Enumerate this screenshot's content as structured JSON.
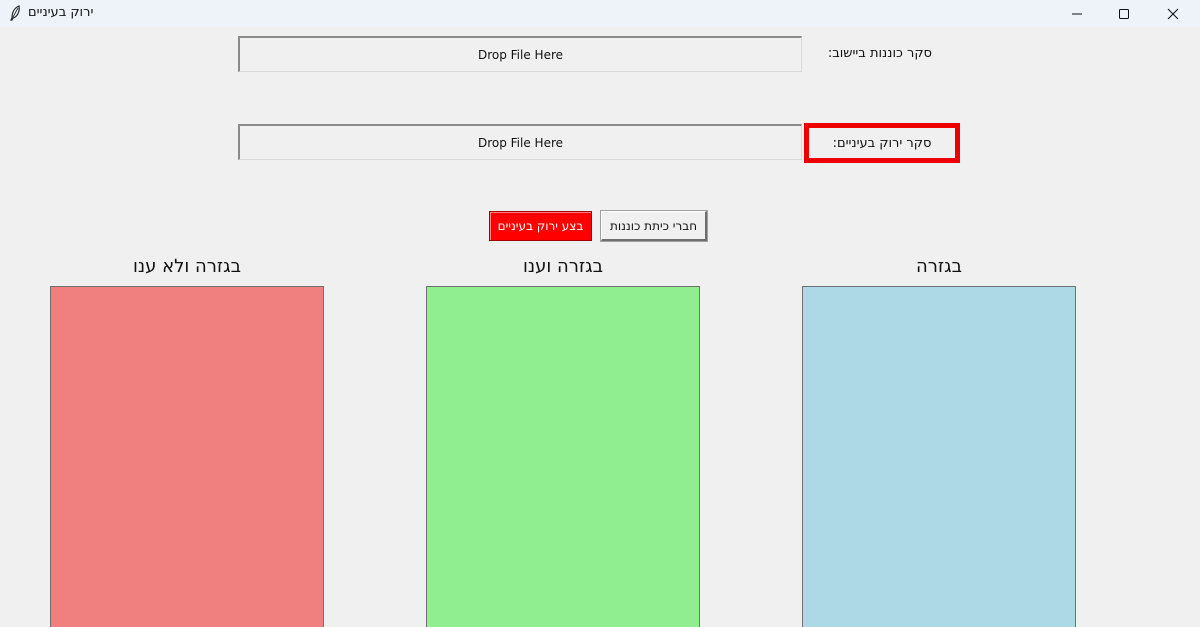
{
  "window": {
    "title": "ירוק בעיניים"
  },
  "inputs": {
    "settlement_survey_label": "סקר כוננות ביישוב:",
    "settlement_survey_drop": "Drop File Here",
    "green_eyes_survey_label": "סקר ירוק בעיניים:",
    "green_eyes_survey_drop": "Drop File Here"
  },
  "actions": {
    "run_label": "בצע ירוק בעיניים",
    "members_label": "חברי כיתת כוננות"
  },
  "columns": [
    {
      "title": "בגזרה ולא ענו",
      "color": "#f08080"
    },
    {
      "title": "בגזרה וענו",
      "color": "#90ee90"
    },
    {
      "title": "בגזרה",
      "color": "#add8e6"
    }
  ],
  "colors": {
    "highlight_border": "#ee0000",
    "run_button_bg": "#ff0000",
    "background": "#f0f0f0"
  }
}
